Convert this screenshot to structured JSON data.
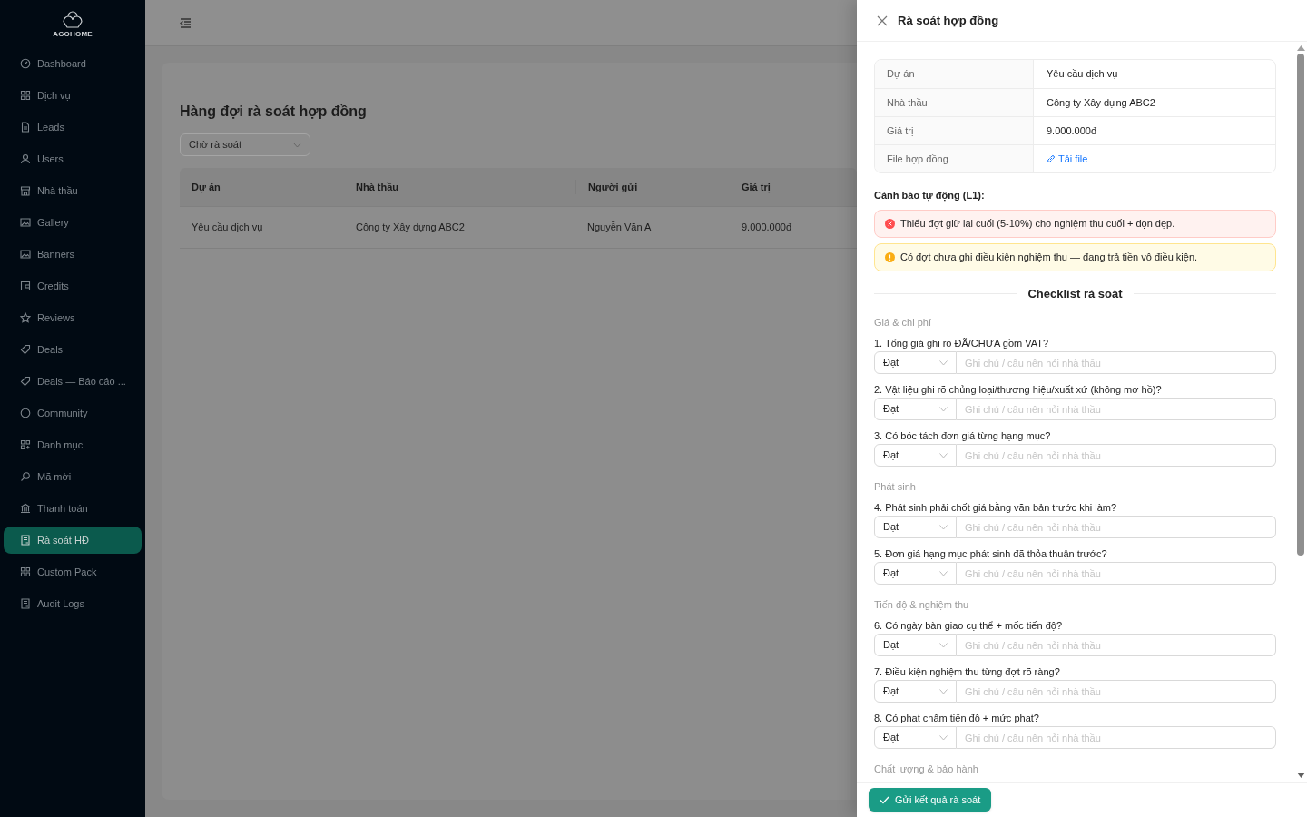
{
  "sidebar": {
    "logo_text": "AGOHOME",
    "items": [
      {
        "label": "Dashboard",
        "selected": false
      },
      {
        "label": "Dịch vụ",
        "selected": false
      },
      {
        "label": "Leads",
        "selected": false
      },
      {
        "label": "Users",
        "selected": false
      },
      {
        "label": "Nhà thầu",
        "selected": false
      },
      {
        "label": "Gallery",
        "selected": false
      },
      {
        "label": "Banners",
        "selected": false
      },
      {
        "label": "Credits",
        "selected": false
      },
      {
        "label": "Reviews",
        "selected": false
      },
      {
        "label": "Deals",
        "selected": false
      },
      {
        "label": "Deals — Báo cáo ...",
        "selected": false
      },
      {
        "label": "Community",
        "selected": false
      },
      {
        "label": "Danh mục",
        "selected": false
      },
      {
        "label": "Mã mời",
        "selected": false
      },
      {
        "label": "Thanh toán",
        "selected": false
      },
      {
        "label": "Rà soát HĐ",
        "selected": true
      },
      {
        "label": "Custom Pack",
        "selected": false
      },
      {
        "label": "Audit Logs",
        "selected": false
      }
    ]
  },
  "main": {
    "title": "Hàng đợi rà soát hợp đồng",
    "filter": "Chờ rà soát",
    "table": {
      "columns": [
        "Dự án",
        "Nhà thầu",
        "Người gửi",
        "Giá trị"
      ],
      "rows": [
        [
          "Yêu cầu dịch vụ",
          "Công ty Xây dựng ABC2",
          "Nguyễn Văn A",
          "9.000.000đ"
        ]
      ]
    }
  },
  "drawer": {
    "title": "Rà soát hợp đồng",
    "info": [
      {
        "label": "Dự án",
        "value": "Yêu cầu dịch vụ",
        "kind": "text"
      },
      {
        "label": "Nhà thầu",
        "value": "Công ty Xây dựng ABC2",
        "kind": "text"
      },
      {
        "label": "Giá trị",
        "value": "9.000.000đ",
        "kind": "text"
      },
      {
        "label": "File hợp đồng",
        "value": "Tải file",
        "kind": "link"
      }
    ],
    "warnings_title": "Cảnh báo tự động (L1):",
    "warnings": [
      {
        "kind": "error",
        "text": "Thiếu đợt giữ lại cuối (5-10%) cho nghiệm thu cuối + dọn dẹp."
      },
      {
        "kind": "warning",
        "text": "Có đợt chưa ghi điều kiện nghiệm thu — đang trả tiền vô điều kiện."
      }
    ],
    "checklist_title": "Checklist rà soát",
    "sections": [
      {
        "title": "Giá & chi phí",
        "items": [
          {
            "question": "1. Tổng giá ghi rõ ĐÃ/CHƯA gồm VAT?",
            "status": "Đạt",
            "placeholder": "Ghi chú / câu nên hỏi nhà thầu"
          },
          {
            "question": "2. Vật liệu ghi rõ chủng loại/thương hiệu/xuất xứ (không mơ hồ)?",
            "status": "Đạt",
            "placeholder": "Ghi chú / câu nên hỏi nhà thầu"
          },
          {
            "question": "3. Có bóc tách đơn giá từng hạng mục?",
            "status": "Đạt",
            "placeholder": "Ghi chú / câu nên hỏi nhà thầu"
          }
        ]
      },
      {
        "title": "Phát sinh",
        "items": [
          {
            "question": "4. Phát sinh phải chốt giá bằng văn bản trước khi làm?",
            "status": "Đạt",
            "placeholder": "Ghi chú / câu nên hỏi nhà thầu"
          },
          {
            "question": "5. Đơn giá hạng mục phát sinh đã thỏa thuận trước?",
            "status": "Đạt",
            "placeholder": "Ghi chú / câu nên hỏi nhà thầu"
          }
        ]
      },
      {
        "title": "Tiến độ & nghiệm thu",
        "items": [
          {
            "question": "6. Có ngày bàn giao cụ thể + mốc tiến độ?",
            "status": "Đạt",
            "placeholder": "Ghi chú / câu nên hỏi nhà thầu"
          },
          {
            "question": "7. Điều kiện nghiệm thu từng đợt rõ ràng?",
            "status": "Đạt",
            "placeholder": "Ghi chú / câu nên hỏi nhà thầu"
          },
          {
            "question": "8. Có phạt chậm tiến độ + mức phạt?",
            "status": "Đạt",
            "placeholder": "Ghi chú / câu nên hỏi nhà thầu"
          }
        ]
      },
      {
        "title": "Chất lượng & bảo hành"
      }
    ],
    "submit": "Gửi kết quả rà soát"
  }
}
